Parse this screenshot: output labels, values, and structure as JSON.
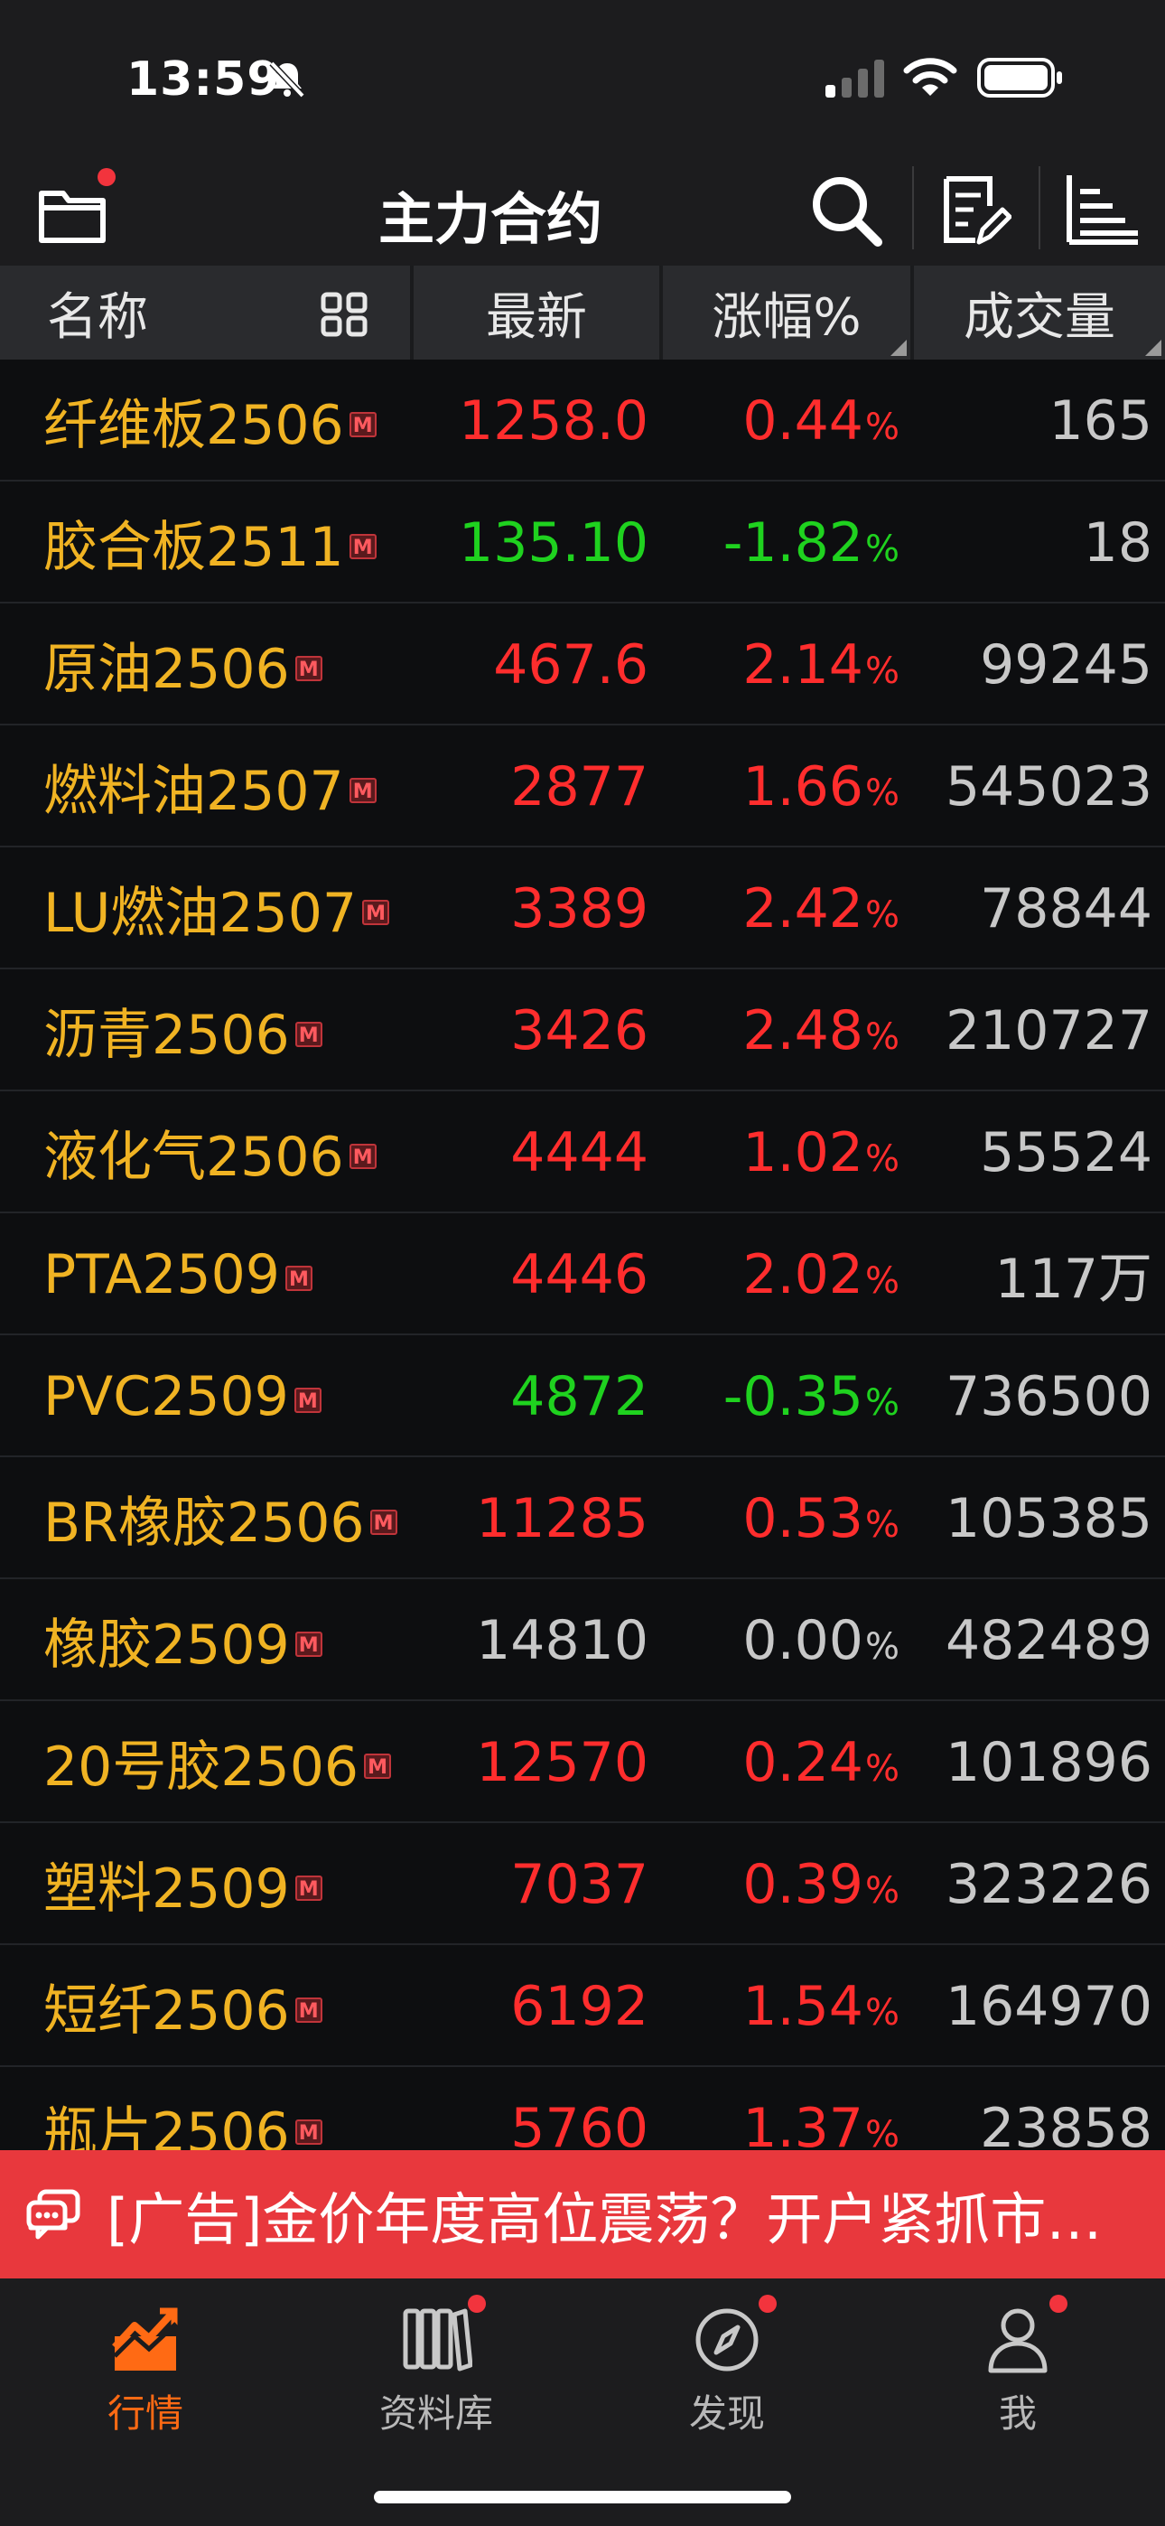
{
  "status_bar": {
    "time": "13:59"
  },
  "nav": {
    "title": "主力合约"
  },
  "columns": {
    "name": "名称",
    "latest": "最新",
    "change": "涨幅%",
    "volume": "成交量"
  },
  "badge_label": "M",
  "rows": [
    {
      "name": "纤维板2506",
      "latest": "1258.0",
      "change": "0.44",
      "volume": "165",
      "trend": "up"
    },
    {
      "name": "胶合板2511",
      "latest": "135.10",
      "change": "-1.82",
      "volume": "18",
      "trend": "down"
    },
    {
      "name": "原油2506",
      "latest": "467.6",
      "change": "2.14",
      "volume": "99245",
      "trend": "up"
    },
    {
      "name": "燃料油2507",
      "latest": "2877",
      "change": "1.66",
      "volume": "545023",
      "trend": "up"
    },
    {
      "name": "LU燃油2507",
      "latest": "3389",
      "change": "2.42",
      "volume": "78844",
      "trend": "up"
    },
    {
      "name": "沥青2506",
      "latest": "3426",
      "change": "2.48",
      "volume": "210727",
      "trend": "up"
    },
    {
      "name": "液化气2506",
      "latest": "4444",
      "change": "1.02",
      "volume": "55524",
      "trend": "up"
    },
    {
      "name": "PTA2509",
      "latest": "4446",
      "change": "2.02",
      "volume": "117万",
      "trend": "up"
    },
    {
      "name": "PVC2509",
      "latest": "4872",
      "change": "-0.35",
      "volume": "736500",
      "trend": "down"
    },
    {
      "name": "BR橡胶2506",
      "latest": "11285",
      "change": "0.53",
      "volume": "105385",
      "trend": "up"
    },
    {
      "name": "橡胶2509",
      "latest": "14810",
      "change": "0.00",
      "volume": "482489",
      "trend": "flat"
    },
    {
      "name": "20号胶2506",
      "latest": "12570",
      "change": "0.24",
      "volume": "101896",
      "trend": "up"
    },
    {
      "name": "塑料2509",
      "latest": "7037",
      "change": "0.39",
      "volume": "323226",
      "trend": "up"
    },
    {
      "name": "短纤2506",
      "latest": "6192",
      "change": "1.54",
      "volume": "164970",
      "trend": "up"
    },
    {
      "name": "瓶片2506",
      "latest": "5760",
      "change": "1.37",
      "volume": "23858",
      "trend": "up"
    }
  ],
  "pct_suffix": "%",
  "ad": {
    "text": "[广告]金价年度高位震荡？开户紧抓市…"
  },
  "tabs": [
    {
      "label": "行情",
      "icon": "market-chart-icon",
      "active": true,
      "dot": false
    },
    {
      "label": "资料库",
      "icon": "library-books-icon",
      "active": false,
      "dot": true
    },
    {
      "label": "发现",
      "icon": "compass-icon",
      "active": false,
      "dot": true
    },
    {
      "label": "我",
      "icon": "person-icon",
      "active": false,
      "dot": true
    }
  ],
  "colors": {
    "up": "#ff2d2d",
    "down": "#1fd21f",
    "flat": "#c8c8c8",
    "name": "#f0b323",
    "accent": "#ff6a14",
    "ad_bg": "#e8383d"
  }
}
